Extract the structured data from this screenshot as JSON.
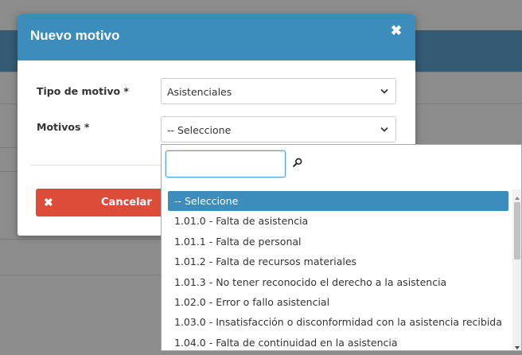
{
  "modal": {
    "title": "Nuevo motivo",
    "close_icon": "close-icon",
    "fields": [
      {
        "label": "Tipo de motivo *",
        "value": "Asistenciales"
      },
      {
        "label": "Motivos *",
        "value": "-- Seleccione"
      }
    ],
    "cancel_label": "Cancelar",
    "cancel_icon": "close-icon"
  },
  "dropdown": {
    "search_value": "",
    "search_icon": "search-icon",
    "options": [
      "-- Seleccione",
      "1.01.0 - Falta de asistencia",
      "1.01.1 - Falta de personal",
      "1.01.2 - Falta de recursos materiales",
      "1.01.3 - No tener reconocido el derecho a la asistencia",
      "1.02.0 - Error o fallo asistencial",
      "1.03.0 - Insatisfacción o disconformidad con la asistencia recibida",
      "1.04.0 - Falta de continuidad en la asistencia"
    ],
    "selected_index": 0
  },
  "colors": {
    "header": "#3c8dbc",
    "danger": "#dd4b39",
    "selected": "#3c8dbc",
    "overlay_background": "#8c8c8c"
  }
}
